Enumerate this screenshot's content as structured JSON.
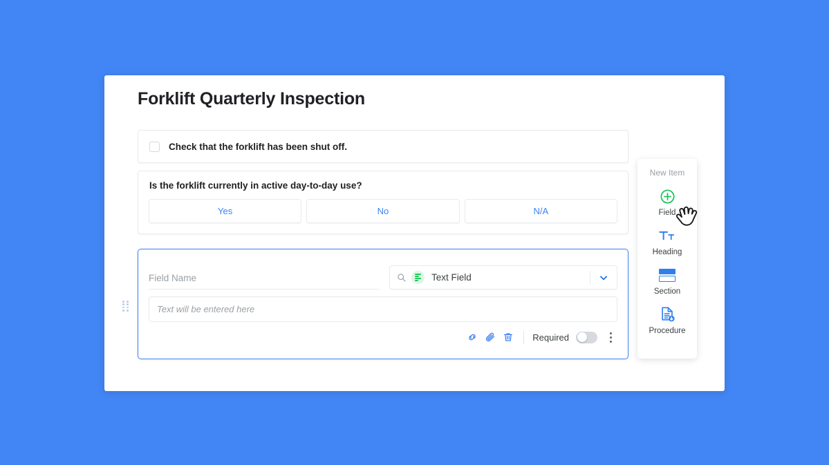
{
  "theme": {
    "background": "#4285f4",
    "accent_blue": "#3b82f6",
    "accent_green": "#22c55e",
    "card_background": "#ffffff",
    "text_primary": "#202124",
    "text_muted": "#9aa0a6"
  },
  "form": {
    "title": "Forklift Quarterly Inspection",
    "checkbox_item": {
      "label": "Check that the forklift has been shut off.",
      "checked": false,
      "icon": "checkbox-unchecked-icon"
    },
    "question_item": {
      "label": "Is the forklift currently in active day-to-day use?",
      "choices": [
        "Yes",
        "No",
        "N/A"
      ]
    },
    "field_editor": {
      "drag_handle_icon": "drag-handle-icon",
      "field_name_placeholder": "Field Name",
      "field_name_value": "",
      "type_select": {
        "search_icon": "search-icon",
        "type_icon": "text-field-icon",
        "selected": "Text Field",
        "chevron_icon": "chevron-down-icon"
      },
      "answer_placeholder": "Text will be entered here",
      "actions": [
        {
          "name": "link-icon",
          "label": "Link"
        },
        {
          "name": "paperclip-icon",
          "label": "Attach"
        },
        {
          "name": "trash-icon",
          "label": "Delete"
        }
      ],
      "required_label": "Required",
      "required_on": false,
      "more_icon": "kebab-menu-icon"
    }
  },
  "new_item_panel": {
    "title": "New Item",
    "items": [
      {
        "label": "Field",
        "icon": "plus-circle-icon"
      },
      {
        "label": "Heading",
        "icon": "heading-text-icon"
      },
      {
        "label": "Section",
        "icon": "section-icon"
      },
      {
        "label": "Procedure",
        "icon": "procedure-document-icon"
      }
    ]
  },
  "cursor": {
    "icon": "hand-pointer-cursor"
  }
}
